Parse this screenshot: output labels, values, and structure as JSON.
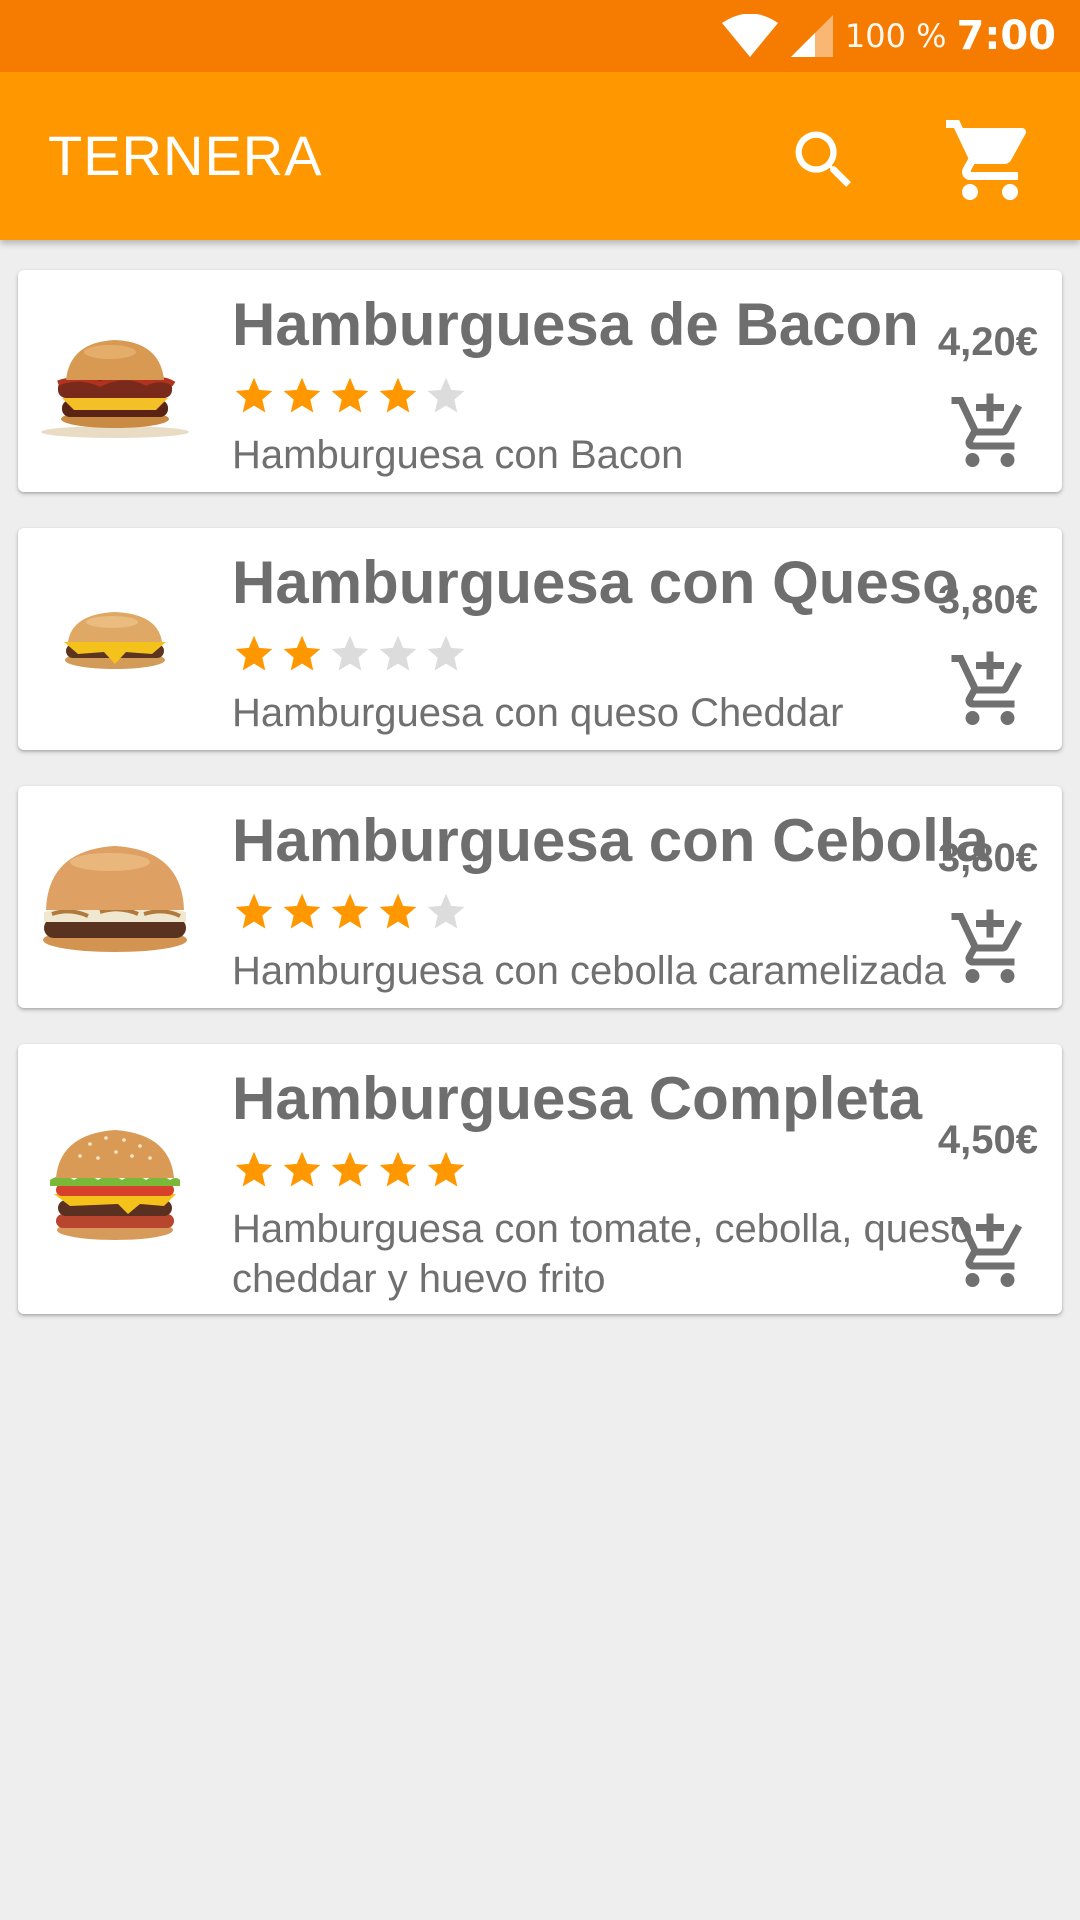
{
  "status_bar": {
    "battery": "100 %",
    "time": "7:00"
  },
  "app_bar": {
    "title": "TERNERA"
  },
  "colors": {
    "status_bar": "#f57c00",
    "app_bar": "#ff9800",
    "star_on": "#ff9800",
    "star_off": "#dcdcdc",
    "text": "#6e6e6e"
  },
  "products": [
    {
      "name": "Hamburguesa de Bacon",
      "rating": 4,
      "max_rating": 5,
      "description": "Hamburguesa con Bacon",
      "price": "4,20€"
    },
    {
      "name": "Hamburguesa con Queso",
      "rating": 2,
      "max_rating": 5,
      "description": "Hamburguesa con queso Cheddar",
      "price": "3,80€"
    },
    {
      "name": "Hamburguesa con Cebolla",
      "rating": 4,
      "max_rating": 5,
      "description": "Hamburguesa con cebolla caramelizada",
      "price": "3,80€"
    },
    {
      "name": "Hamburguesa Completa",
      "rating": 5,
      "max_rating": 5,
      "description": "Hamburguesa con tomate, cebolla, queso cheddar y huevo frito",
      "price": "4,50€"
    }
  ]
}
